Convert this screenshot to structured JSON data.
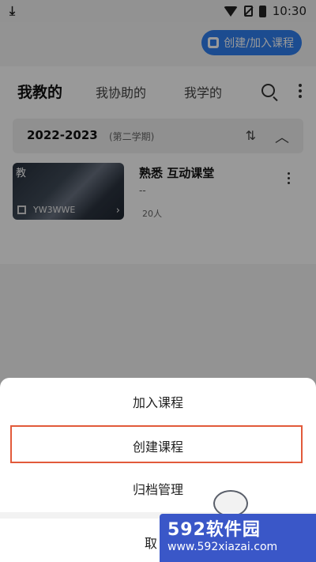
{
  "status_bar": {
    "time": "10:30"
  },
  "header": {
    "create_join_label": "创建/加入课程"
  },
  "tabs": [
    {
      "label": "我教的",
      "active": true
    },
    {
      "label": "我协助的",
      "active": false
    },
    {
      "label": "我学的",
      "active": false
    }
  ],
  "term": {
    "year": "2022-2023",
    "semester": "(第二学期)"
  },
  "course": {
    "cover_tag": "教",
    "code": "YW3WWE",
    "title": "熟悉 互动课堂",
    "subtitle": "--",
    "count": "20人"
  },
  "sheet": {
    "join": "加入课程",
    "create": "创建课程",
    "archive": "归档管理",
    "cancel": "取"
  },
  "watermark": {
    "title": "592软件园",
    "url": "www.592xiazai.com"
  },
  "colors": {
    "accent": "#2f7ff0",
    "highlight": "#e25a3a"
  }
}
